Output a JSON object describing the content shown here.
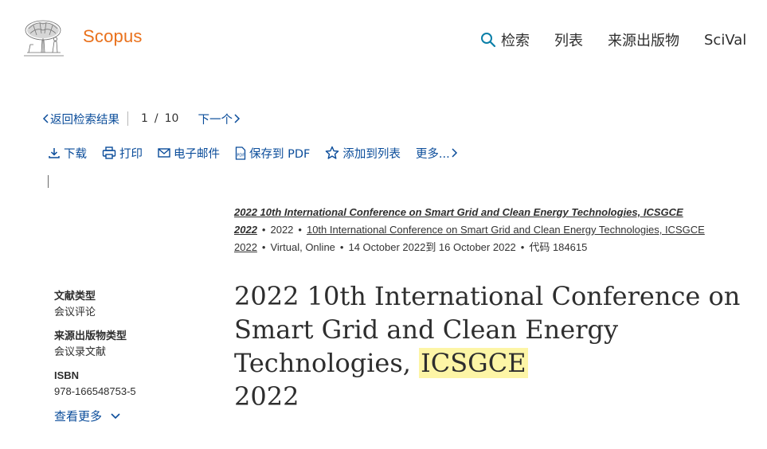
{
  "header": {
    "brand": "Scopus",
    "nav": [
      {
        "label": "检索",
        "icon": "search-icon"
      },
      {
        "label": "列表"
      },
      {
        "label": "来源出版物"
      },
      {
        "label": "SciVal"
      }
    ]
  },
  "pager": {
    "back_label": "返回检索结果",
    "current": "1",
    "slash": "/",
    "total": "10",
    "next_label": "下一个"
  },
  "toolbar": {
    "download": "下载",
    "print": "打印",
    "email": "电子邮件",
    "save_pdf": "保存到 PDF",
    "add_to_list": "添加到列表",
    "more": "更多..."
  },
  "meta": {
    "source_title": "2022 10th International Conference on Smart Grid and Clean Energy Technologies, ICSGCE 2022",
    "year": "2022",
    "conference_name": "10th International Conference on Smart Grid and Clean Energy Technologies, ICSGCE 2022",
    "location": "Virtual, Online",
    "dates": "14 October 2022到 16 October 2022",
    "code": "代码 184615"
  },
  "document": {
    "title_before": "2022 10th International Conference on Smart Grid and Clean Energy Technologies,",
    "title_highlight": "ICSGCE",
    "title_after": "2022"
  },
  "info": {
    "doc_type_label": "文献类型",
    "doc_type_value": "会议评论",
    "source_type_label": "来源出版物类型",
    "source_type_value": "会议录文献",
    "isbn_label": "ISBN",
    "isbn_value": "978-166548753-5",
    "show_more": "查看更多"
  },
  "colors": {
    "brand": "#e9711c",
    "link": "#0a4c9a",
    "highlight": "#fdf5a6"
  }
}
